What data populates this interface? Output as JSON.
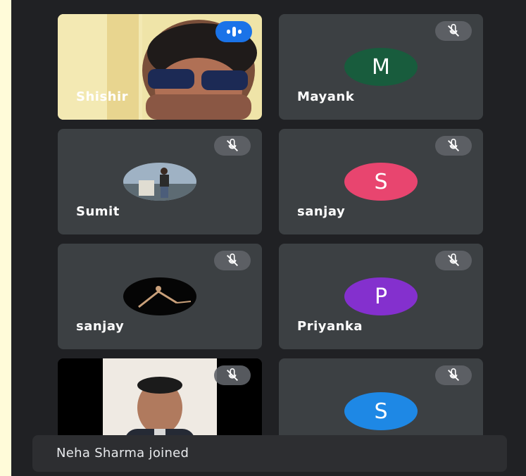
{
  "participants": {
    "tile1": {
      "name": "Shishir"
    },
    "tile2": {
      "name": "Mayank",
      "initial": "M",
      "color": "#185c3d"
    },
    "tile3": {
      "name": "Sumit"
    },
    "tile4": {
      "name": "sanjay",
      "initial": "S",
      "color": "#e8456f"
    },
    "tile5": {
      "name": "sanjay"
    },
    "tile6": {
      "name": "Priyanka",
      "initial": "P",
      "color": "#8430ce"
    },
    "tile8": {
      "initial": "S",
      "color": "#1e88e5"
    }
  },
  "notification": {
    "text": "Neha Sharma joined"
  },
  "icons": {
    "mute": "mic-off-icon",
    "speaking": "audio-level-icon"
  }
}
